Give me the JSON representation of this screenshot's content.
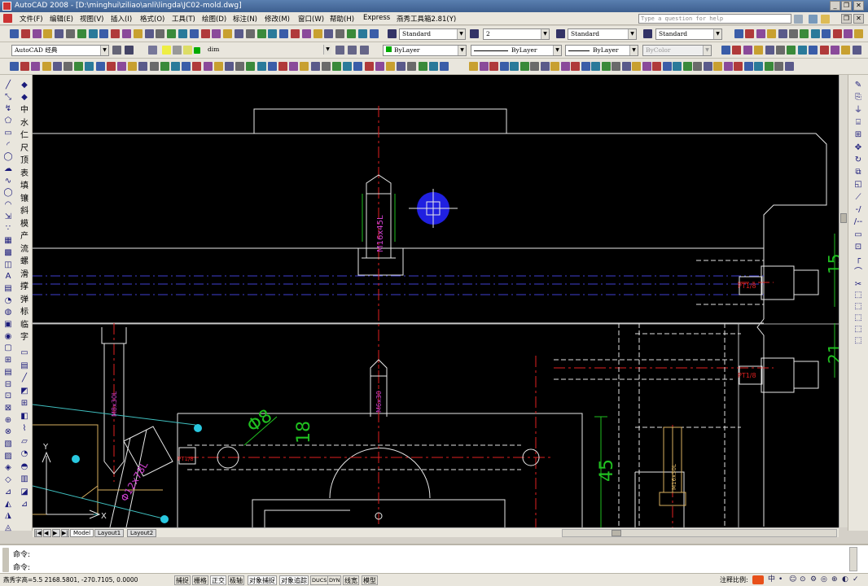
{
  "title": "AutoCAD 2008 - [D:\\minghui\\ziliao\\anli\\lingda\\JC02-mold.dwg]",
  "window_buttons": {
    "minimize": "_",
    "restore": "❐",
    "close": "✕"
  },
  "menu": [
    "文件(F)",
    "编辑(E)",
    "视图(V)",
    "插入(I)",
    "格式(O)",
    "工具(T)",
    "绘图(D)",
    "标注(N)",
    "修改(M)",
    "窗口(W)",
    "帮助(H)",
    "Express",
    "燕秀工具箱2.81(Y)"
  ],
  "question_box": {
    "placeholder": "Type a question for help"
  },
  "toolbar1": {
    "text_style": "Standard",
    "dim_style_value": "2",
    "table_style": "Standard",
    "multileader_style": "Standard"
  },
  "toolbar2": {
    "workspace": "AutoCAD 经典",
    "layer": "dim",
    "color": "ByLayer",
    "linetype": "ByLayer",
    "lineweight": "ByLayer",
    "plotstyle": "ByColor"
  },
  "left_chars": [
    "中",
    "水",
    "仁",
    "尺",
    "顶",
    "表",
    "填",
    "镶",
    "斜",
    "模",
    "产",
    "流",
    "螺",
    "滑",
    "撑",
    "弹",
    "标",
    "临",
    "字"
  ],
  "drawing": {
    "thread_vertical_1": "M16x45L",
    "thread_vertical_2": "M8x30L",
    "thread_vertical_3": "M6x30",
    "thread_angled": "M16x30L",
    "fitting_1": "PT1/8",
    "fitting_2": "PT1/8",
    "fitting_3": "PT1/8",
    "diameter": "Φ12x78L",
    "dim_phi": "Φ8",
    "dim_18": "18",
    "dim_45": "45",
    "dim_15": "15",
    "dim_21": "21",
    "ucs_y": "Y",
    "ucs_x": "X"
  },
  "tabs": [
    "Model",
    "Layout1",
    "Layout2"
  ],
  "command": {
    "line1": "命令:",
    "line2": "命令:"
  },
  "status": {
    "coords": "燕秀字高=5.5  2168.5801, -270.7105, 0.0000",
    "buttons": [
      "捕捉",
      "栅格",
      "正交",
      "极轴",
      "对象捕捉",
      "对象追踪",
      "DUCS",
      "DYN",
      "线宽",
      "模型"
    ],
    "annotation_scale": "注释比例:"
  }
}
